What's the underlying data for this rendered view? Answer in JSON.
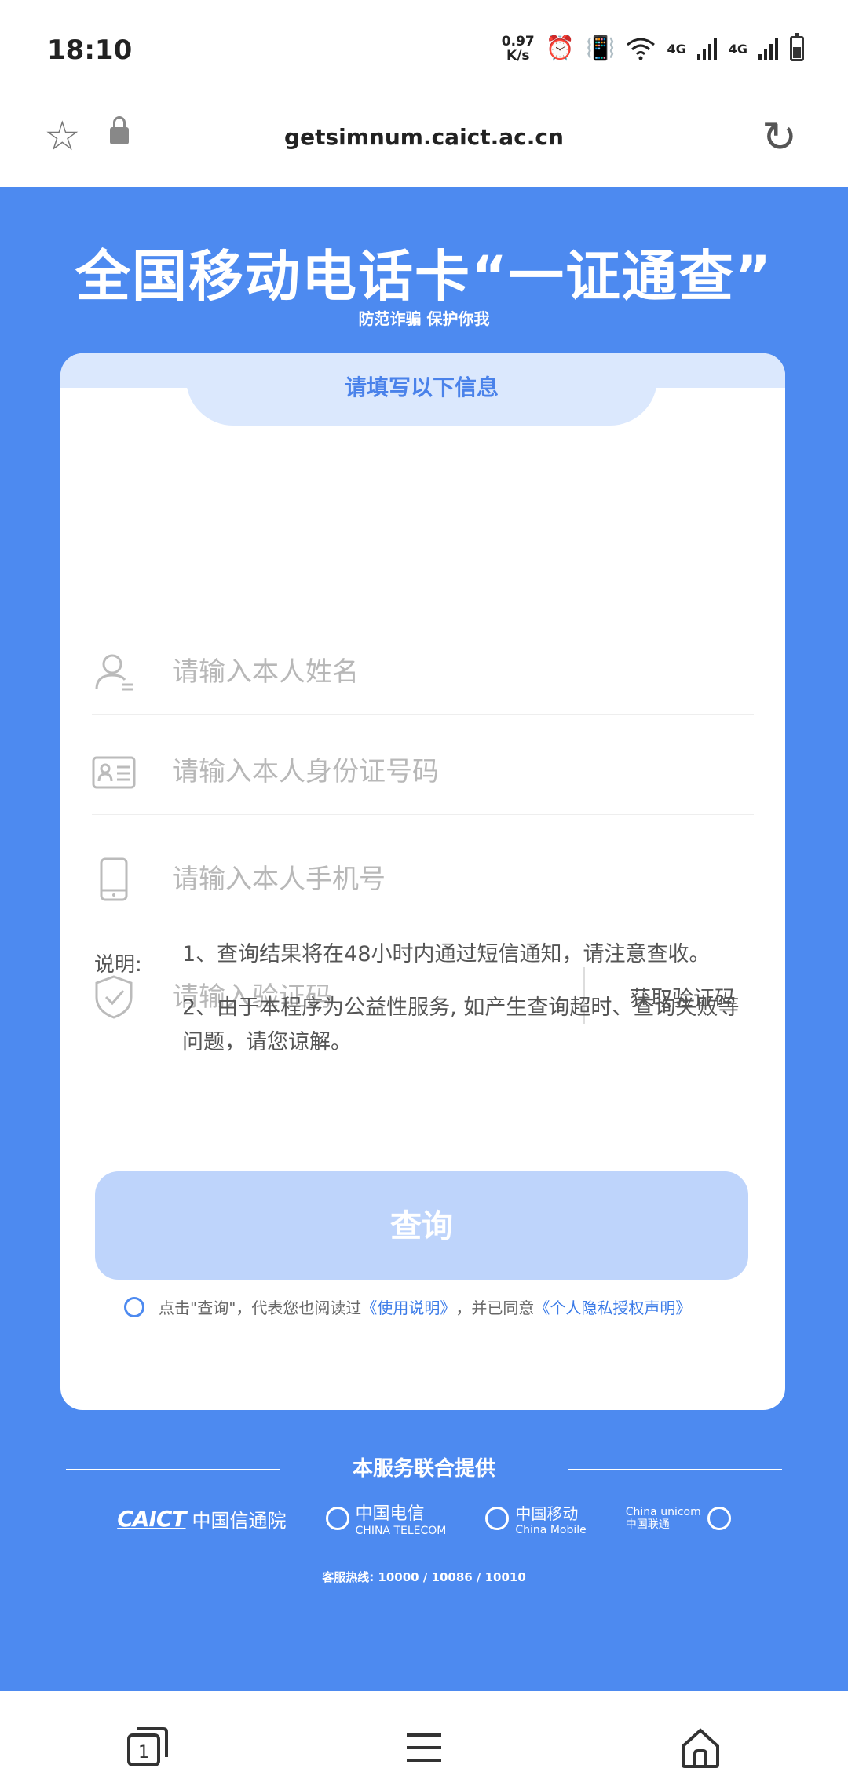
{
  "status_bar": {
    "time": "18:10",
    "net_speed_value": "0.97",
    "net_speed_unit": "K/s",
    "net_type_1": "4G",
    "net_type_2": "4G"
  },
  "browser": {
    "url": "getsimnum.caict.ac.cn"
  },
  "hero": {
    "title": "全国移动电话卡“一证通查”",
    "subtitle": "防范诈骗 保护你我"
  },
  "form": {
    "header": "请填写以下信息",
    "name_placeholder": "请输入本人姓名",
    "id_placeholder": "请输入本人身份证号码",
    "phone_placeholder": "请输入本人手机号",
    "code_placeholder": "请输入验证码",
    "get_code_label": "获取验证码"
  },
  "notes": {
    "label": "说明:",
    "items": [
      "1、查询结果将在48小时内通过短信通知，请注意查收。",
      "2、由于本程序为公益性服务, 如产生查询超时、查询失败等问题，请您谅解。"
    ]
  },
  "query_button": "查询",
  "agreement": {
    "prefix": "点击\"查询\"，代表您也阅读过",
    "usage_link": "《使用说明》",
    "middle": "，并已同意",
    "privacy_link": "《个人隐私授权声明》"
  },
  "footer": {
    "title": "本服务联合提供",
    "logos": {
      "caict_abbr": "CAICT",
      "caict_name": "中国信通院",
      "telecom_name": "中国电信",
      "telecom_en": "CHINA TELECOM",
      "mobile_name": "中国移动",
      "mobile_en": "China Mobile",
      "unicom_en": "China unicom",
      "unicom_name": "中国联通"
    },
    "hotline": "客服热线: 10000 / 10086 / 10010"
  },
  "bottom_nav": {
    "tab_count": "1"
  }
}
